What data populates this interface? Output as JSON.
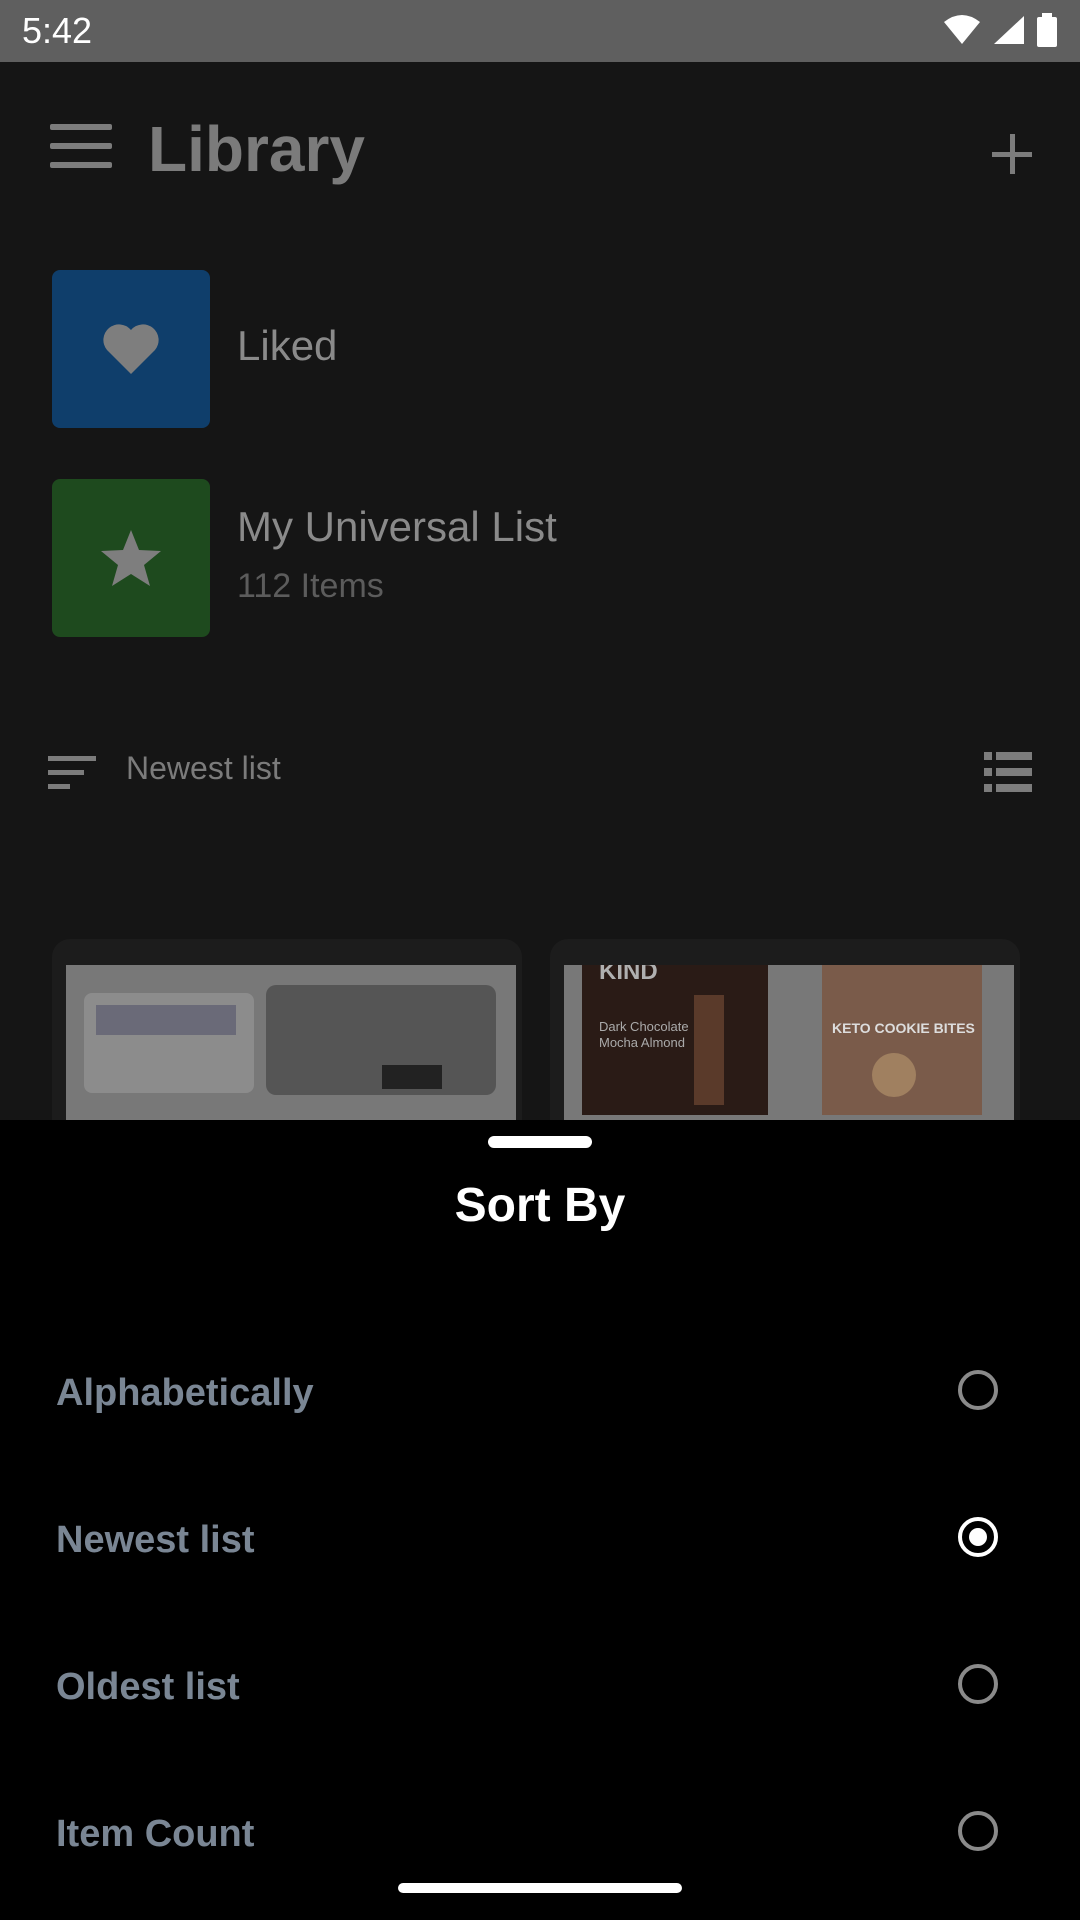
{
  "status_bar": {
    "time": "5:42"
  },
  "header": {
    "title": "Library"
  },
  "library": {
    "items": [
      {
        "name": "Liked",
        "sub": "",
        "color": "#0f3e6b",
        "icon": "heart-icon"
      },
      {
        "name": "My Universal List",
        "sub": "112 Items",
        "color": "#1e4a1e",
        "icon": "star-icon"
      }
    ]
  },
  "sort_bar": {
    "label": "Newest list"
  },
  "cards": [
    {
      "kind": "home-appliances"
    },
    {
      "kind": "snacks-supplements",
      "brand": "KIND",
      "product": "Dark Chocolate Mocha Almond",
      "other": "KETO COOKIE BITES"
    }
  ],
  "sheet": {
    "title": "Sort By",
    "options": [
      {
        "label": "Alphabetically",
        "selected": false
      },
      {
        "label": "Newest list",
        "selected": true
      },
      {
        "label": "Oldest list",
        "selected": false
      },
      {
        "label": "Item Count",
        "selected": false
      }
    ]
  }
}
